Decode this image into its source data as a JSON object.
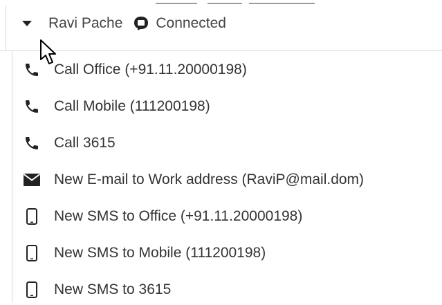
{
  "header": {
    "contact_name": "Ravi Pache",
    "status": "Connected",
    "caret_icon": "caret-down-icon",
    "status_icon": "chat-bubble-icon"
  },
  "menu": {
    "items": [
      {
        "icon": "phone-icon",
        "label": "Call Office (+91.11.20000198)"
      },
      {
        "icon": "phone-icon",
        "label": "Call Mobile (111200198)"
      },
      {
        "icon": "phone-icon",
        "label": "Call 3615"
      },
      {
        "icon": "envelope-icon",
        "label": "New E-mail to Work address (RaviP@mail.dom)"
      },
      {
        "icon": "mobile-phone-icon",
        "label": "New SMS to Office (+91.11.20000198)"
      },
      {
        "icon": "mobile-phone-icon",
        "label": "New SMS to Mobile (111200198)"
      },
      {
        "icon": "mobile-phone-icon",
        "label": "New SMS to 3615"
      }
    ]
  },
  "colors": {
    "text": "#333333",
    "icon": "#222222",
    "border": "#d9d9d9"
  }
}
